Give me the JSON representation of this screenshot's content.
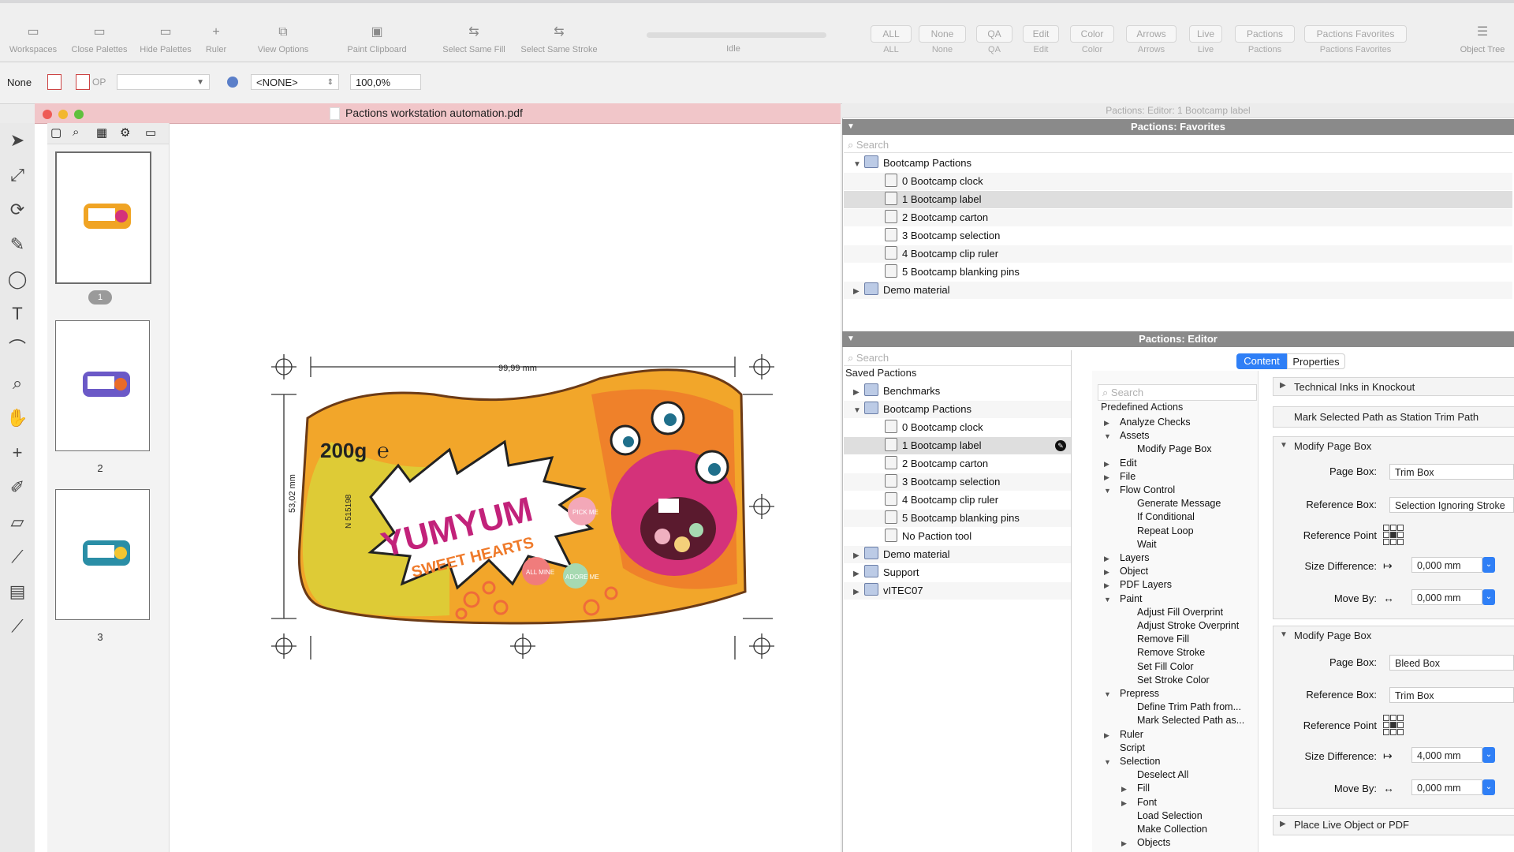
{
  "toolbar": {
    "items": [
      {
        "label": "Workspaces",
        "icon": "workspaces-icon",
        "glyph": "▭"
      },
      {
        "label": "Close Palettes",
        "icon": "close-palettes-icon",
        "glyph": "▭"
      },
      {
        "label": "Hide Palettes",
        "icon": "hide-palettes-icon",
        "glyph": "▭"
      },
      {
        "label": "Ruler",
        "icon": "ruler-icon",
        "glyph": "+"
      },
      {
        "label": "View Options",
        "icon": "view-options-icon",
        "glyph": "⧉"
      },
      {
        "label": "Paint Clipboard",
        "icon": "paint-clipboard-icon",
        "glyph": "▣"
      },
      {
        "label": "Select Same Fill",
        "icon": "select-same-fill-icon",
        "glyph": "⇆"
      },
      {
        "label": "Select Same Stroke",
        "icon": "select-same-stroke-icon",
        "glyph": "⇆"
      }
    ],
    "status": "Idle",
    "buttons": [
      "ALL",
      "None",
      "QA",
      "Edit",
      "Color",
      "Arrows",
      "Live",
      "Pactions",
      "Pactions Favorites"
    ],
    "object_tree": "Object Tree"
  },
  "bar2": {
    "none_label": "None",
    "op_label": "OP",
    "swatch_value": "<NONE>",
    "zoom": "100,0%"
  },
  "document": {
    "title": "Pactions workstation automation.pdf",
    "pages": [
      "1",
      "2",
      "3"
    ],
    "dimension_width": "99,99 mm",
    "dimension_height": "53,02 mm",
    "label_weight": "200g",
    "label_estimated": "℮",
    "label_brand": "YUMYUM",
    "label_sub": "SWEET HEARTS",
    "label_code": "N 515198",
    "label_heart1": "PICK ME",
    "label_heart2": "ALL MINE",
    "label_heart3": "ADORE ME"
  },
  "panel_title": "Pactions: Editor: 1 Bootcamp label",
  "favorites": {
    "title": "Pactions: Favorites",
    "search_placeholder": "Search",
    "items": [
      {
        "label": "Bootcamp Pactions",
        "type": "folder",
        "expanded": true,
        "indent": 0
      },
      {
        "label": "0 Bootcamp clock",
        "type": "action",
        "indent": 1
      },
      {
        "label": "1 Bootcamp label",
        "type": "action",
        "indent": 1,
        "selected": true
      },
      {
        "label": "2 Bootcamp carton",
        "type": "action",
        "indent": 1
      },
      {
        "label": "3 Bootcamp selection",
        "type": "action",
        "indent": 1
      },
      {
        "label": "4 Bootcamp clip ruler",
        "type": "action",
        "indent": 1
      },
      {
        "label": "5 Bootcamp blanking pins",
        "type": "action",
        "indent": 1
      },
      {
        "label": "Demo material",
        "type": "folder",
        "expanded": false,
        "indent": 0
      }
    ]
  },
  "editor": {
    "title": "Pactions: Editor",
    "search_placeholder": "Search",
    "saved_label": "Saved Pactions",
    "items": [
      {
        "label": "Benchmarks",
        "type": "folder",
        "expanded": false,
        "indent": 0
      },
      {
        "label": "Bootcamp Pactions",
        "type": "folder",
        "expanded": true,
        "indent": 0
      },
      {
        "label": "0 Bootcamp clock",
        "type": "action",
        "indent": 1
      },
      {
        "label": "1 Bootcamp label",
        "type": "action",
        "indent": 1,
        "selected": true
      },
      {
        "label": "2 Bootcamp carton",
        "type": "action",
        "indent": 1
      },
      {
        "label": "3 Bootcamp selection",
        "type": "action",
        "indent": 1
      },
      {
        "label": "4 Bootcamp clip ruler",
        "type": "action",
        "indent": 1
      },
      {
        "label": "5 Bootcamp blanking pins",
        "type": "action",
        "indent": 1
      },
      {
        "label": "No Paction tool",
        "type": "action",
        "indent": 1
      },
      {
        "label": "Demo material",
        "type": "folder",
        "expanded": false,
        "indent": 0
      },
      {
        "label": "Support",
        "type": "folder",
        "expanded": false,
        "indent": 0
      },
      {
        "label": "vITEC07",
        "type": "folder",
        "expanded": false,
        "indent": 0
      }
    ],
    "tabs": [
      "Content",
      "Properties"
    ],
    "actions_search_placeholder": "Search",
    "predefined_label": "Predefined Actions",
    "predefined": [
      {
        "label": "Analyze Checks",
        "tri": "▶",
        "indent": 0
      },
      {
        "label": "Assets",
        "tri": "▼",
        "indent": 0
      },
      {
        "label": "Modify Page Box",
        "tri": "",
        "indent": 1
      },
      {
        "label": "Edit",
        "tri": "▶",
        "indent": 0
      },
      {
        "label": "File",
        "tri": "▶",
        "indent": 0
      },
      {
        "label": "Flow Control",
        "tri": "▼",
        "indent": 0
      },
      {
        "label": "Generate Message",
        "tri": "",
        "indent": 1
      },
      {
        "label": "If Conditional",
        "tri": "",
        "indent": 1
      },
      {
        "label": "Repeat Loop",
        "tri": "",
        "indent": 1
      },
      {
        "label": "Wait",
        "tri": "",
        "indent": 1
      },
      {
        "label": "Layers",
        "tri": "▶",
        "indent": 0
      },
      {
        "label": "Object",
        "tri": "▶",
        "indent": 0
      },
      {
        "label": "PDF Layers",
        "tri": "▶",
        "indent": 0
      },
      {
        "label": "Paint",
        "tri": "▼",
        "indent": 0
      },
      {
        "label": "Adjust Fill Overprint",
        "tri": "",
        "indent": 1
      },
      {
        "label": "Adjust Stroke Overprint",
        "tri": "",
        "indent": 1
      },
      {
        "label": "Remove Fill",
        "tri": "",
        "indent": 1
      },
      {
        "label": "Remove Stroke",
        "tri": "",
        "indent": 1
      },
      {
        "label": "Set Fill Color",
        "tri": "",
        "indent": 1
      },
      {
        "label": "Set Stroke Color",
        "tri": "",
        "indent": 1
      },
      {
        "label": "Prepress",
        "tri": "▼",
        "indent": 0
      },
      {
        "label": "Define Trim Path from...",
        "tri": "",
        "indent": 1
      },
      {
        "label": "Mark Selected Path as...",
        "tri": "",
        "indent": 1
      },
      {
        "label": "Ruler",
        "tri": "▶",
        "indent": 0
      },
      {
        "label": "Script",
        "tri": "",
        "indent": 0
      },
      {
        "label": "Selection",
        "tri": "▼",
        "indent": 0
      },
      {
        "label": "Deselect All",
        "tri": "",
        "indent": 1
      },
      {
        "label": "Fill",
        "tri": "▶",
        "indent": 1
      },
      {
        "label": "Font",
        "tri": "▶",
        "indent": 1
      },
      {
        "label": "Load Selection",
        "tri": "",
        "indent": 1
      },
      {
        "label": "Make Collection",
        "tri": "",
        "indent": 1
      },
      {
        "label": "Objects",
        "tri": "▶",
        "indent": 1
      }
    ],
    "steps": {
      "step1": "Technical Inks in Knockout",
      "step2": "Mark Selected Path as Station Trim Path",
      "modify1": {
        "title": "Modify Page Box",
        "page_box_label": "Page Box:",
        "page_box": "Trim Box",
        "reference_box_label": "Reference Box:",
        "reference_box": "Selection Ignoring Stroke",
        "reference_point_label": "Reference Point",
        "size_diff_label": "Size Difference:",
        "size_diff": "0,000 mm",
        "move_by_label": "Move By:",
        "move_by": "0,000 mm"
      },
      "modify2": {
        "title": "Modify Page Box",
        "page_box_label": "Page Box:",
        "page_box": "Bleed Box",
        "reference_box_label": "Reference Box:",
        "reference_box": "Trim Box",
        "reference_point_label": "Reference Point",
        "size_diff_label": "Size Difference:",
        "size_diff": "4,000 mm",
        "move_by_label": "Move By:",
        "move_by": "0,000 mm"
      },
      "step5": "Place Live Object or PDF"
    }
  },
  "colors": {
    "accent": "#2f7ff6",
    "doc_title_bg": "#f1c6c9",
    "panel_header": "#8a8a8a"
  }
}
